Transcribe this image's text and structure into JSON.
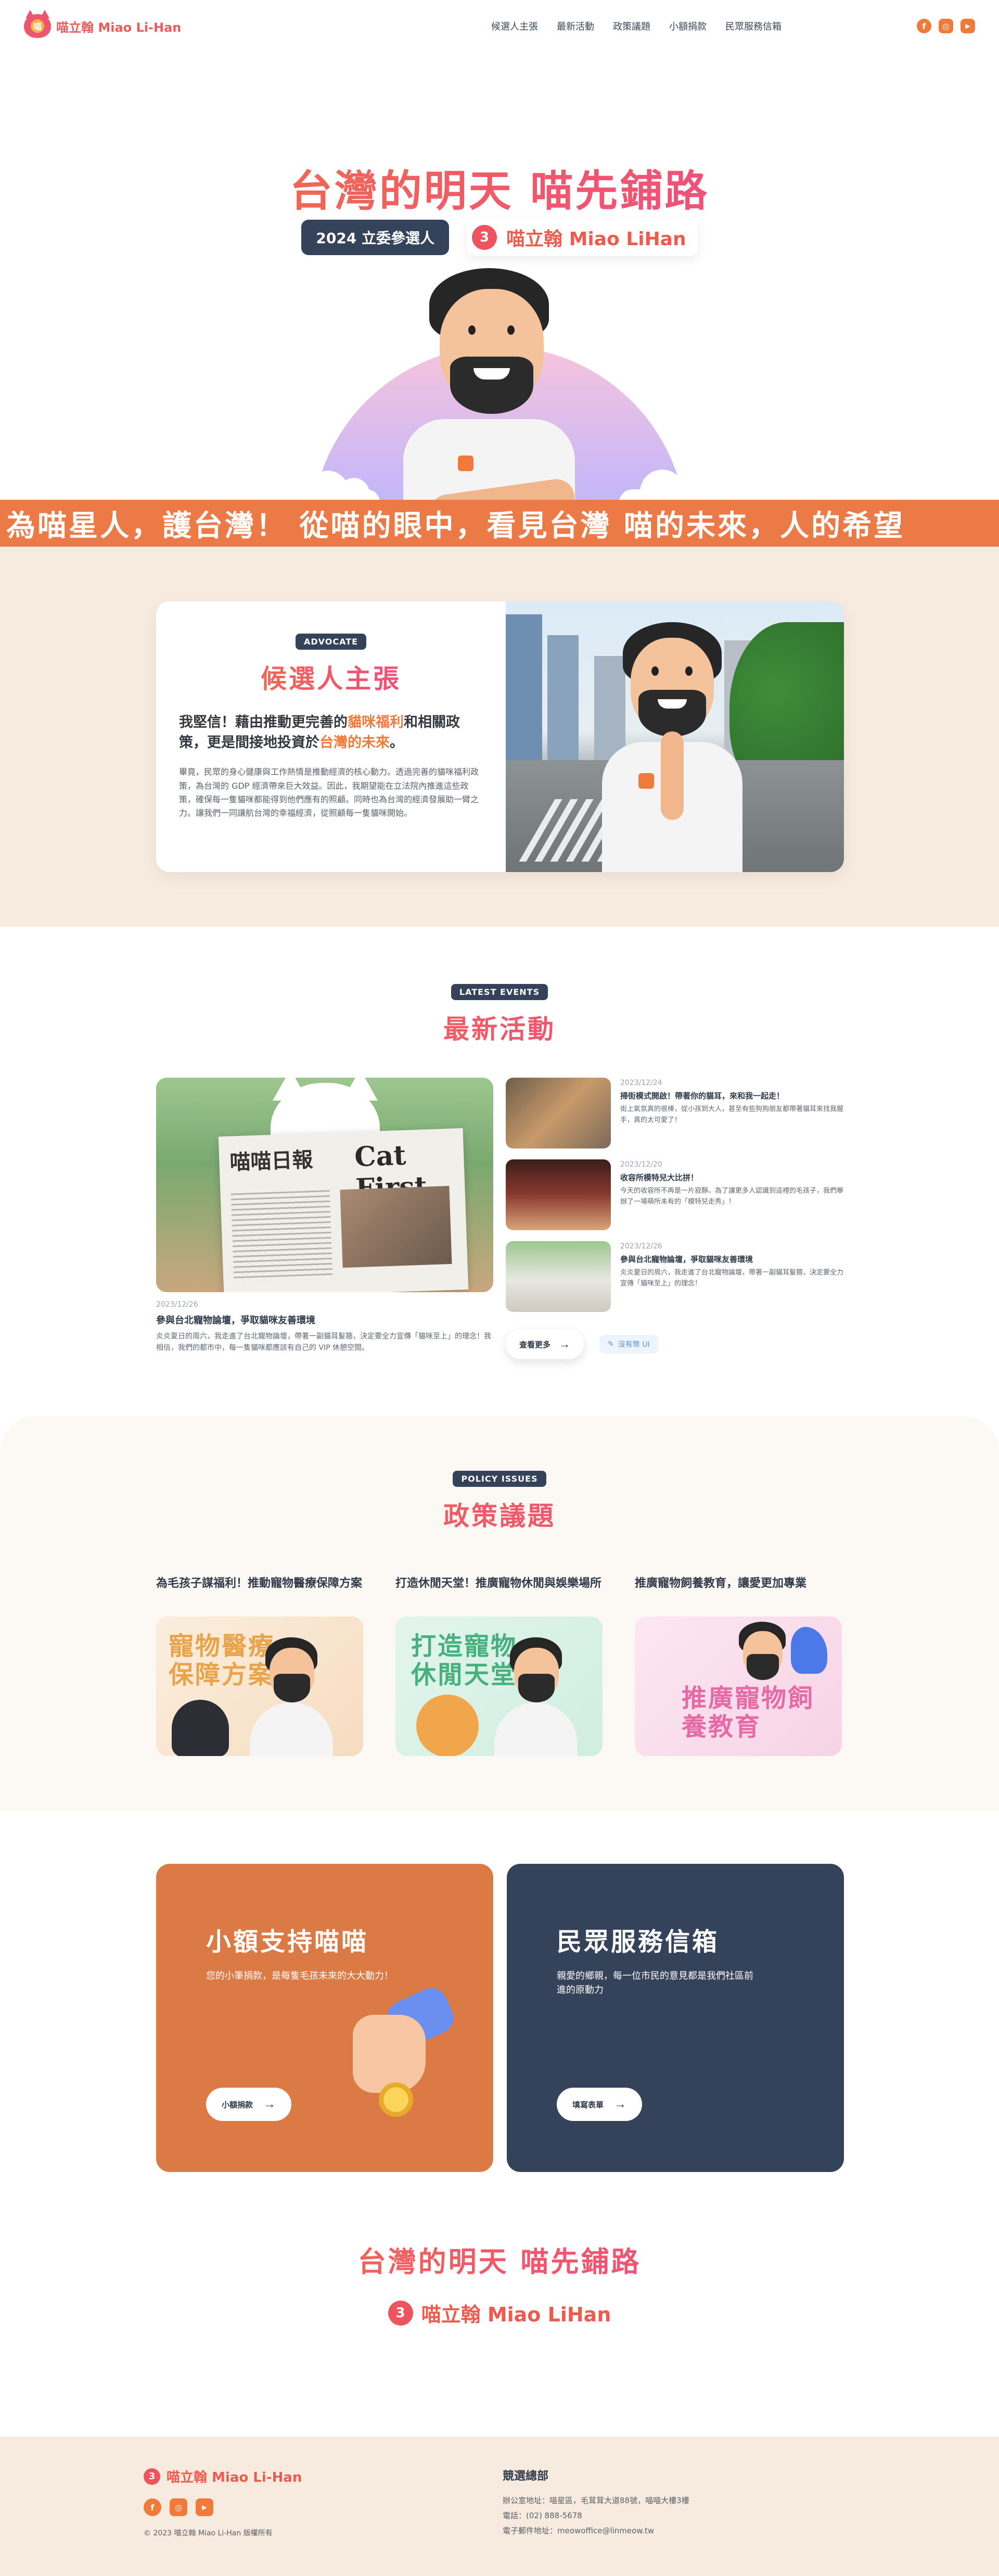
{
  "header": {
    "brand_logo_char": "喵",
    "brand": "喵立翰 Miao Li-Han",
    "nav": [
      "候選人主張",
      "最新活動",
      "政策議題",
      "小額捐款",
      "民眾服務信箱"
    ],
    "socials": [
      "facebook-icon",
      "instagram-icon",
      "youtube-icon"
    ]
  },
  "hero": {
    "title": "台灣的明天 喵先鋪路",
    "tag": "2024 立委參選人",
    "number": "3",
    "candidate": "喵立翰 Miao LiHan",
    "shirt_logo": "喵"
  },
  "marquee": {
    "text": "為喵星人，護台灣！ 從喵的眼中，看見台灣 喵的未來，人的希望"
  },
  "advocate": {
    "tag": "ADVOCATE",
    "title": "候選人主張",
    "lead_1": "我堅信！藉由推動更完善的",
    "lead_hl_1": "貓咪福利",
    "lead_2": "和相關政策，更是間接地投資於",
    "lead_hl_2": "台灣的未來",
    "lead_3": "。",
    "body": "畢竟，民眾的身心健康與工作熱情是推動經濟的核心動力。透過完善的貓咪福利政策，為台灣的 GDP 經濟帶來巨大效益。因此，我期望能在立法院內推進這些政策，確保每一隻貓咪都能得到他們應有的照顧。同時也為台灣的經濟發展助一臂之力。讓我們一同讓航台灣的幸福經濟，從照顧每一隻貓咪開始。"
  },
  "events": {
    "tag": "LATEST EVENTS",
    "title": "最新活動",
    "feature": {
      "date": "2023/12/26",
      "title": "參與台北寵物論壇，爭取貓咪友善環境",
      "desc": "炎炎夏日的周六，我走進了台北寵物論壇，帶著一副貓耳髮箍，決定要全力宣傳「貓咪至上」的理念！我相信，我們的都市中，每一隻貓咪都應該有自己的 VIP 休憩空間。",
      "headline_left": "喵喵日報",
      "headline_right": "Cat First"
    },
    "list": [
      {
        "date": "2023/12/24",
        "title": "掃街模式開啟！帶著你的貓耳，來和我一起走！",
        "desc": "街上氣氛真的很棒，從小孩到大人，甚至有些狗狗朋友都帶著貓耳來找我握手，真的太可愛了！"
      },
      {
        "date": "2023/12/20",
        "title": "收容所模特兒大比拼！",
        "desc": "今天的收容所不再是一片寂靜。為了讓更多人認識到這裡的毛孩子，我們舉辦了一場萌所未有的「模特兒走秀」！"
      },
      {
        "date": "2023/12/26",
        "title": "參與台北寵物論壇，爭取貓咪友善環境",
        "desc": "炎炎夏日的周六，我走進了台北寵物論壇，帶著一副貓耳髮箍，決定要全力宣傳「貓咪至上」的理念！"
      }
    ],
    "more": "查看更多",
    "no_data": "沒有幣 UI"
  },
  "policy": {
    "tag": "POLICY ISSUES",
    "title": "政策議題",
    "items": [
      {
        "title": "為毛孩子謀福利！推動寵物醫療保障方案",
        "img_text": "寵物醫療保障方案"
      },
      {
        "title": "打造休閒天堂！推廣寵物休閒與娛樂場所",
        "img_text": "打造寵物休閒天堂"
      },
      {
        "title": "推廣寵物飼養教育，讓愛更加專業",
        "img_text": "推廣寵物飼養教育"
      }
    ]
  },
  "support": {
    "donate": {
      "title": "小額支持喵喵",
      "desc": "您的小筆捐款，是每隻毛孩未來的大大動力！",
      "button": "小額捐款"
    },
    "mail": {
      "title": "民眾服務信箱",
      "desc": "親愛的鄉親，每一位市民的意見都是我們社區前進的原動力",
      "button": "填寫表單"
    },
    "closing_title": "台灣的明天 喵先鋪路",
    "closing_number": "3",
    "closing_candidate": "喵立翰 Miao LiHan"
  },
  "footer": {
    "number": "3",
    "brand": "喵立翰 Miao Li-Han",
    "copyright": "© 2023 喵立翰 Miao Li-Han 版權所有",
    "office_title": "競選總部",
    "address": "辦公室地址：喵星區，毛茸茸大道88號，喵喵大樓3樓",
    "phone": "電話：(02) 888-5678",
    "email": "電子郵件地址：meowoffice@linmeow.tw"
  },
  "colors": {
    "accent_orange": "#f07a3a",
    "accent_pink": "#ee4a8c",
    "navy": "#34425a",
    "beige": "#f7ebdf"
  }
}
